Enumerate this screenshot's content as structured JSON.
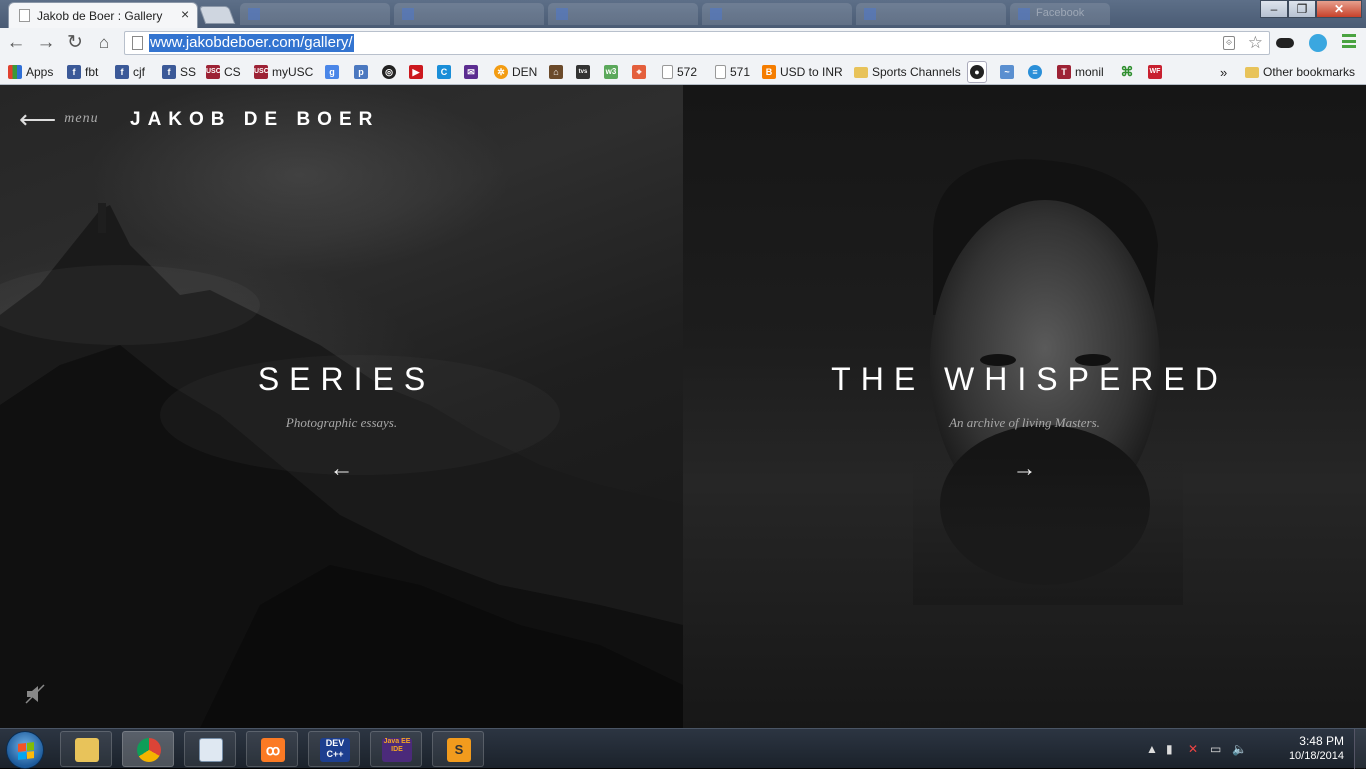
{
  "browser": {
    "active_tab_title": "Jakob de Boer : Gallery",
    "tab_close": "×",
    "background_tabs": [
      "",
      "",
      "",
      "",
      "",
      "",
      "",
      "Facebook"
    ],
    "url": "www.jakobdeboer.com/gallery/",
    "window_controls": [
      "–",
      "❐",
      "✕"
    ]
  },
  "bookmarks": {
    "items": [
      {
        "label": "Apps",
        "icon": "apps-icon",
        "color": "#e0412f"
      },
      {
        "label": "fbt",
        "icon": "facebook-icon",
        "color": "#3b5998"
      },
      {
        "label": "cjf",
        "icon": "facebook-icon",
        "color": "#3b5998"
      },
      {
        "label": "SS",
        "icon": "facebook-icon",
        "color": "#3b5998"
      },
      {
        "label": "CS",
        "icon": "usc-icon",
        "color": "#9d2235"
      },
      {
        "label": "myUSC",
        "icon": "usc-icon",
        "color": "#9d2235"
      },
      {
        "label": "",
        "icon": "google-icon",
        "color": "#4a86e8"
      },
      {
        "label": "",
        "icon": "p-icon",
        "color": "#4b78c0"
      },
      {
        "label": "",
        "icon": "circle-icon",
        "color": "#222222"
      },
      {
        "label": "",
        "icon": "youtube-icon",
        "color": "#cc181e"
      },
      {
        "label": "",
        "icon": "c-icon",
        "color": "#1a8ed8"
      },
      {
        "label": "",
        "icon": "mail-icon",
        "color": "#5c2d91"
      },
      {
        "label": "DEN",
        "icon": "den-icon",
        "color": "#f39c12"
      },
      {
        "label": "",
        "icon": "bank-icon",
        "color": "#6b4a2a"
      },
      {
        "label": "",
        "icon": "tv-icon",
        "color": "#333333"
      },
      {
        "label": "",
        "icon": "w3-icon",
        "color": "#5ba85b"
      },
      {
        "label": "",
        "icon": "maps-icon",
        "color": "#e45f3c"
      },
      {
        "label": "572",
        "icon": "page-icon",
        "color": "#999999"
      },
      {
        "label": "571",
        "icon": "page-icon",
        "color": "#999999"
      },
      {
        "label": "USD to INR",
        "icon": "blogger-icon",
        "color": "#f57d00"
      },
      {
        "label": "Sports Channels",
        "icon": "folder-icon",
        "color": "#e8c35a"
      },
      {
        "label": "",
        "icon": "github-icon",
        "color": "#222222"
      },
      {
        "label": "",
        "icon": "fish-icon",
        "color": "#5a8fd0"
      },
      {
        "label": "",
        "icon": "att-icon",
        "color": "#2a8fd8"
      },
      {
        "label": "monil",
        "icon": "usc-icon",
        "color": "#9d2235"
      },
      {
        "label": "",
        "icon": "cmd-icon",
        "color": "#2f8f2f"
      },
      {
        "label": "",
        "icon": "wf-icon",
        "color": "#c8202f"
      }
    ],
    "overflow": "»",
    "other": "Other bookmarks"
  },
  "page": {
    "menu_arrow": "⟵",
    "menu_label": "menu",
    "site_title": "JAKOB DE BOER",
    "left": {
      "title": "SERIES",
      "subtitle": "Photographic essays.",
      "arrow": "←"
    },
    "right": {
      "title": "THE WHISPERED",
      "subtitle": "An archive of living Masters.",
      "arrow": "→"
    }
  },
  "taskbar": {
    "apps": [
      {
        "name": "explorer",
        "label": ""
      },
      {
        "name": "chrome",
        "label": ""
      },
      {
        "name": "notepad",
        "label": ""
      },
      {
        "name": "xampp",
        "label": ""
      },
      {
        "name": "devcpp",
        "label": "DEV C++"
      },
      {
        "name": "javaee",
        "label": "Java EE IDE"
      },
      {
        "name": "sublime",
        "label": "S"
      }
    ],
    "time": "3:48 PM",
    "date": "10/18/2014"
  }
}
